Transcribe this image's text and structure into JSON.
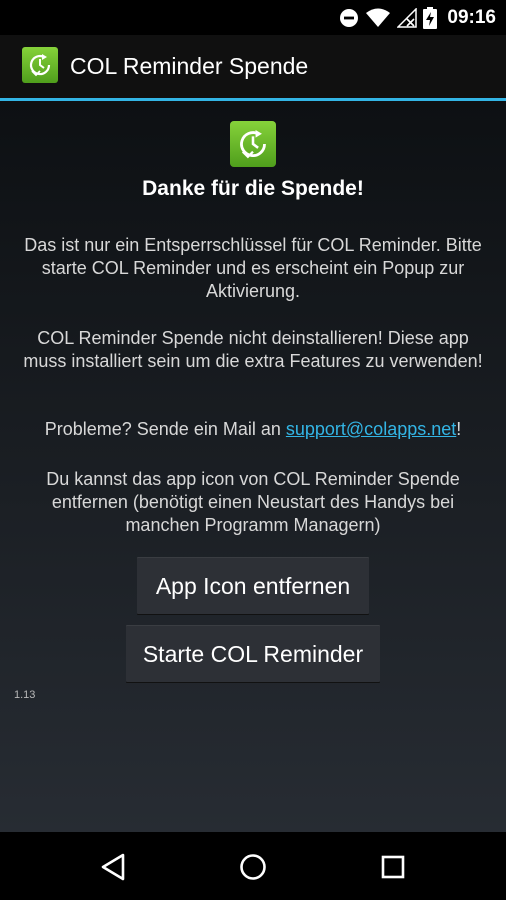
{
  "status_bar": {
    "time": "09:16",
    "icons": [
      "do-not-disturb-icon",
      "wifi-icon",
      "no-signal-icon",
      "battery-charging-icon"
    ]
  },
  "action_bar": {
    "title": "COL Reminder Spende",
    "logo_icon": "col-reminder-logo-icon"
  },
  "content": {
    "heading": "Danke für die Spende!",
    "paragraph_1": "Das ist nur ein Entsperrschlüssel für COL Reminder. Bitte starte COL Reminder und es erscheint ein Popup zur Aktivierung.",
    "paragraph_2": "COL Reminder Spende nicht deinstallieren! Diese app muss installiert sein um die extra Features zu verwenden!",
    "paragraph_3_prefix": "Probleme? Sende ein Mail an ",
    "support_email": "support@colapps.net",
    "paragraph_3_suffix": "!",
    "paragraph_4": "Du kannst das app icon von COL Reminder Spende entfernen (benötigt einen Neustart des Handys bei manchen Programm Managern)",
    "remove_icon_button": "App Icon entfernen",
    "start_button": "Starte COL Reminder",
    "version": "1.13"
  },
  "nav_bar": {
    "icons": [
      "back-icon",
      "home-icon",
      "recent-apps-icon"
    ]
  },
  "colors": {
    "accent": "#33b5e5",
    "logo_green": "#6abf2a"
  }
}
